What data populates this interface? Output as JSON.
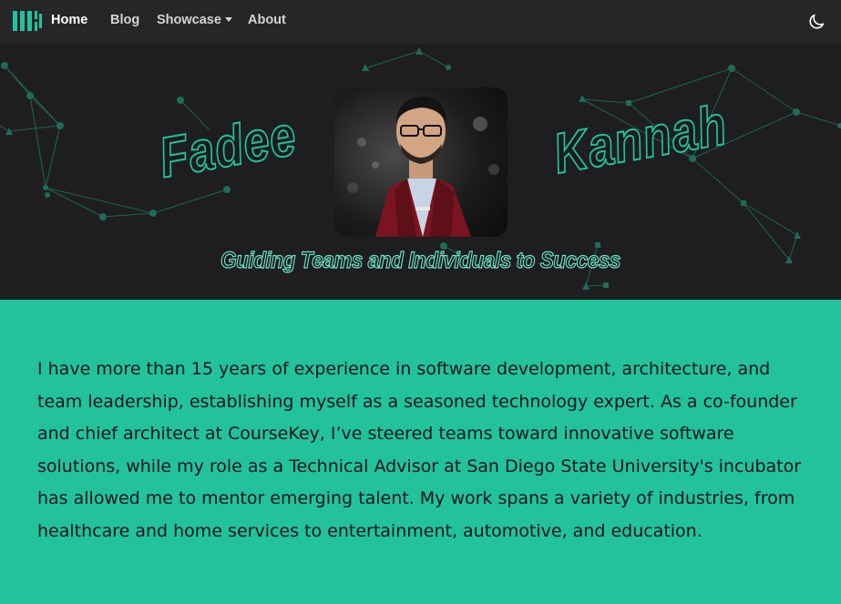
{
  "nav": {
    "logo_icon": "columns-logo-icon",
    "items": [
      {
        "label": "Home",
        "active": true
      },
      {
        "label": "Blog"
      },
      {
        "label": "Showcase",
        "has_dropdown": true
      },
      {
        "label": "About"
      }
    ],
    "theme_toggle_icon": "moon-icon"
  },
  "hero": {
    "first_name": "Fadee",
    "last_name": "Kannah",
    "tagline": "Guiding Teams and Individuals to Success",
    "background_color": "#1e1e20",
    "accent_color": "#21c29c"
  },
  "about": {
    "text": "I have more than 15 years of experience in software development, architecture, and team leadership, establishing myself as a seasoned technology expert. As a co-founder and chief architect at CourseKey, I’ve steered teams toward innovative software solutions, while my role as a Technical Advisor at San Diego State University's incubator has allowed me to mentor emerging talent. My work spans a variety of industries, from healthcare and home services to entertainment, automotive, and education.",
    "background_color": "#21c29c"
  }
}
